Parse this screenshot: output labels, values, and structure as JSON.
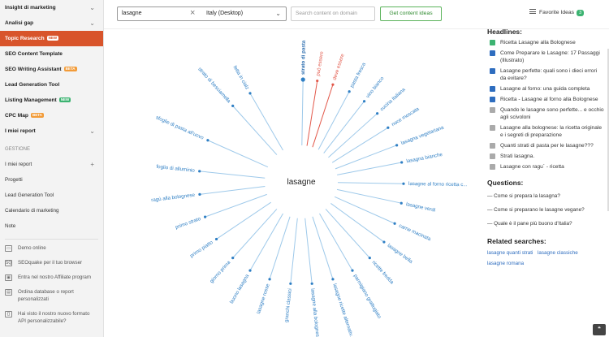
{
  "sidebar": {
    "items": [
      {
        "label": "Insight di marketing",
        "badge": "",
        "chevron": true,
        "active": false
      },
      {
        "label": "Analisi gap",
        "badge": "",
        "chevron": true,
        "active": false
      },
      {
        "label": "Topic Research",
        "badge": "NEW",
        "chevron": false,
        "active": true
      },
      {
        "label": "SEO Content Template",
        "badge": "",
        "chevron": false,
        "active": false
      },
      {
        "label": "SEO Writing Assistant",
        "badge": "BETA",
        "chevron": false,
        "active": false
      },
      {
        "label": "Lead Generation Tool",
        "badge": "",
        "chevron": false,
        "active": false
      },
      {
        "label": "Listing Management",
        "badge": "NEW",
        "chevron": false,
        "active": false
      },
      {
        "label": "CPC Map",
        "badge": "BETA",
        "chevron": false,
        "active": false
      },
      {
        "label": "I miei report",
        "badge": "",
        "chevron": true,
        "active": false
      }
    ],
    "section_label": "GESTIONE",
    "gestione": [
      {
        "label": "I miei report",
        "plus": true
      },
      {
        "label": "Progetti",
        "plus": false
      },
      {
        "label": "Lead Generation Tool",
        "plus": false
      },
      {
        "label": "Calendario di marketing",
        "plus": false
      },
      {
        "label": "Note",
        "plus": false
      }
    ],
    "help": [
      {
        "icon": "monitor-icon",
        "label": "Demo online"
      },
      {
        "icon": "seoquake-icon",
        "label": "SEOquake per il tuo browser"
      },
      {
        "icon": "affiliate-icon",
        "label": "Entra nel nostro Affiliate program"
      },
      {
        "icon": "database-icon",
        "label": "Ordina database o report personalizzati"
      },
      {
        "icon": "api-icon",
        "label": "Hai visto il nostro nuovo formato API personalizzabile?"
      }
    ]
  },
  "toolbar": {
    "search_value": "lasagne",
    "database": "Italy (Desktop)",
    "domain_placeholder": "Search content on domain",
    "get_ideas_label": "Get content ideas",
    "favorite_label": "Favorite Ideas",
    "favorite_count": "3"
  },
  "mindmap": {
    "center": "lasagne",
    "colors": {
      "line": "#9ec9ea",
      "label": "#2f7fc4",
      "highlight": "#e2584a",
      "bold": "#2f6fb0"
    },
    "nodes": [
      {
        "label": "strato di pasta",
        "angle": -89,
        "style": "bold"
      },
      {
        "label": "può essere",
        "angle": -81,
        "style": "red"
      },
      {
        "label": "deve essere",
        "angle": -72,
        "style": "red"
      },
      {
        "label": "pasta fresca",
        "angle": -62,
        "style": "normal"
      },
      {
        "label": "vino bianco",
        "angle": -52,
        "style": "normal"
      },
      {
        "label": "cucina italiana",
        "angle": -42,
        "style": "normal"
      },
      {
        "label": "noce moscata",
        "angle": -32,
        "style": "normal"
      },
      {
        "label": "lasagna vegetariana",
        "angle": -21,
        "style": "normal"
      },
      {
        "label": "lasagna bianche",
        "angle": -11,
        "style": "normal"
      },
      {
        "label": "lasagne al forno ricetta c...",
        "angle": 1,
        "style": "normal"
      },
      {
        "label": "lasagne verdi",
        "angle": 12,
        "style": "normal"
      },
      {
        "label": "carne macinata",
        "angle": 24,
        "style": "normal"
      },
      {
        "label": "lasagne bella",
        "angle": 36,
        "style": "normal"
      },
      {
        "label": "ricette fredda",
        "angle": 48,
        "style": "normal"
      },
      {
        "label": "parmigiano grattugiato",
        "angle": 60,
        "style": "normal"
      },
      {
        "label": "lasagne ricette alternativ...",
        "angle": 72,
        "style": "normal"
      },
      {
        "label": "lasagne alla bolognese ric...",
        "angle": 84,
        "style": "normal"
      },
      {
        "label": "granchi classici",
        "angle": 96,
        "style": "normal"
      },
      {
        "label": "lasagne rosse",
        "angle": 108,
        "style": "normal"
      },
      {
        "label": "buono lasagna",
        "angle": 120,
        "style": "normal"
      },
      {
        "label": "giorno prima",
        "angle": 132,
        "style": "normal"
      },
      {
        "label": "primo piatto",
        "angle": 146,
        "style": "normal"
      },
      {
        "label": "primo strato",
        "angle": 160,
        "style": "normal"
      },
      {
        "label": "ragù alla bolognese",
        "angle": 173,
        "style": "normal"
      },
      {
        "label": "foglio di alluminio",
        "angle": 186,
        "style": "normal"
      },
      {
        "label": "sfoglie di pasta all'uovo",
        "angle": 204,
        "style": "normal"
      },
      {
        "label": "strato di besciamella",
        "angle": 228,
        "style": "normal"
      },
      {
        "label": "fetta in cialz",
        "angle": 240,
        "style": "normal"
      }
    ]
  },
  "headlines": {
    "title": "Headlines:",
    "items": [
      {
        "text": "Ricetta Lasagne alla Bolognese",
        "icon_color": "#3cb371"
      },
      {
        "text": "Come Preparare le Lasagne: 17 Passaggi (Illustrato)",
        "icon_color": "#2e6dbf"
      },
      {
        "text": "Lasagne perfette: quali sono i dieci errori da evitare?",
        "icon_color": "#2e6dbf"
      },
      {
        "text": "Lasagne al forno: una guida completa",
        "icon_color": "#2e6dbf"
      },
      {
        "text": "Ricetta - Lasagne al forno alla Bolognese",
        "icon_color": "#2e6dbf"
      },
      {
        "text": "Quando le lasagne sono perfette... e occhio agli scivoloni",
        "icon_color": "#aaaaaa"
      },
      {
        "text": "Lasagne alla bolognese: la ricetta originale e i segreti di preparazione",
        "icon_color": "#aaaaaa"
      },
      {
        "text": "Quanti strati di pasta per le lasagne???",
        "icon_color": "#aaaaaa"
      },
      {
        "text": "Strati lasagna.",
        "icon_color": "#aaaaaa"
      },
      {
        "text": "Lasagne con ragu` - ricetta",
        "icon_color": "#aaaaaa"
      }
    ]
  },
  "questions": {
    "title": "Questions:",
    "items": [
      "— Come si prepara la lasagna?",
      "— Come si preparano le lasagne vegane?",
      "— Quale è il pane più buono d'Italia?"
    ]
  },
  "related": {
    "title": "Related searches:",
    "items": [
      "lasagne quanti strati",
      "lasagne classiche",
      "lasagne romana"
    ]
  }
}
